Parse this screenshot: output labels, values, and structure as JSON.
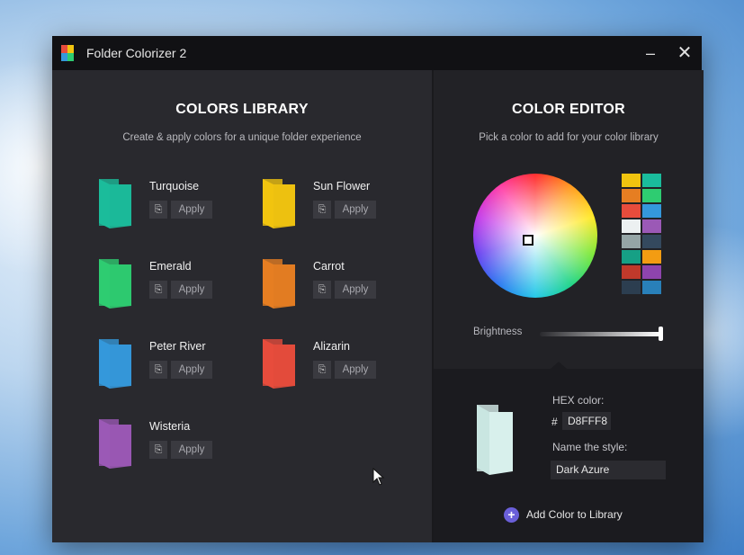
{
  "window": {
    "title": "Folder Colorizer 2",
    "minimize": "–",
    "close": "✕"
  },
  "library": {
    "title": "COLORS LIBRARY",
    "subtitle": "Create & apply colors for a unique folder experience",
    "copy_glyph": "⎘",
    "items": [
      {
        "name": "Turquoise",
        "color": "#1bbc9b",
        "apply": "Apply"
      },
      {
        "name": "Sun Flower",
        "color": "#f1c40f",
        "apply": "Apply"
      },
      {
        "name": "Emerald",
        "color": "#2ecc71",
        "apply": "Apply"
      },
      {
        "name": "Carrot",
        "color": "#e67e22",
        "apply": "Apply"
      },
      {
        "name": "Peter River",
        "color": "#3498db",
        "apply": "Apply"
      },
      {
        "name": "Alizarin",
        "color": "#e74c3c",
        "apply": "Apply"
      },
      {
        "name": "Wisteria",
        "color": "#9b59b6",
        "apply": "Apply"
      }
    ]
  },
  "editor": {
    "title": "COLOR EDITOR",
    "subtitle": "Pick a color to add for your color library",
    "swatches": [
      "#f1c40f",
      "#1abc9c",
      "#e67e22",
      "#2ecc71",
      "#e74c3c",
      "#3498db",
      "#ecf0f1",
      "#9b59b6",
      "#95a5a6",
      "#34495e",
      "#16a085",
      "#f39c12",
      "#c0392b",
      "#8e44ad",
      "#2c3e50",
      "#2980b9"
    ],
    "brightness_label": "Brightness",
    "brightness": 1.0,
    "hex_label": "HEX color:",
    "hash": "#",
    "hex_value": "D8FFF8",
    "preview_color": "#d8f0ec",
    "name_label": "Name the style:",
    "name_value": "Dark Azure",
    "add_button": "Add Color to Library"
  }
}
